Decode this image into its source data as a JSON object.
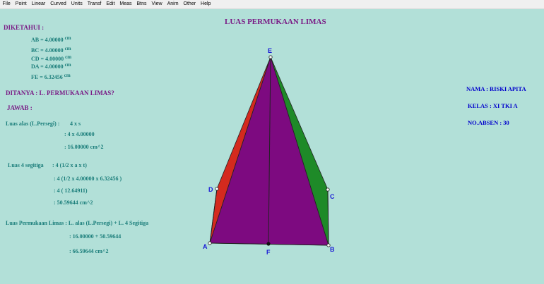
{
  "menu": [
    "File",
    "Point",
    "Linear",
    "Curved",
    "Units",
    "Transf",
    "Edit",
    "Meas",
    "Btns",
    "View",
    "Anim",
    "Other",
    "Help"
  ],
  "title": "LUAS PERMUKAAN LIMAS",
  "diketahui": {
    "heading": "DIKETAHUI :",
    "measures": [
      {
        "text": "AB = 4.00000",
        "unit": "cm"
      },
      {
        "text": "BC = 4.00000",
        "unit": "cm"
      },
      {
        "text": "CD = 4.00000",
        "unit": "cm"
      },
      {
        "text": "DA = 4.00000",
        "unit": "cm"
      },
      {
        "text": "FE = 6.32456",
        "unit": "cm"
      }
    ]
  },
  "ditanya": "DITANYA : L. PERMUKAAN LIMAS?",
  "jawab": "JAWAB :",
  "luas_alas": {
    "label": "Luas alas (L.Persegi) :",
    "expr": "4 x s",
    "step1": ": 4 x  4.00000",
    "result": ": 16.00000  cm^2"
  },
  "luas_segitiga": {
    "label": "Luas 4 segitiga",
    "expr": ": 4 (1/2 x a x t)",
    "step1": ": 4 (1/2 x  4.00000  x  6.32456 )",
    "step2": ": 4 (  12.64911)",
    "result": ": 50.59644  cm^2"
  },
  "luas_permukaan": {
    "label": "Luas Permukaan Limas : L. alas (L.Persegi) + L. 4 Segitiga",
    "step1": ":  16.00000   +   50.59644",
    "result": ":  66.59644  cm^2"
  },
  "student": {
    "nama": "NAMA : RISKI APITA",
    "kelas": "KELAS : XI TKI A",
    "absen": "NO.ABSEN : 30"
  },
  "vertices": {
    "A": "A",
    "B": "B",
    "C": "C",
    "D": "D",
    "E": "E",
    "F": "F"
  },
  "colors": {
    "background": "#b2e0d8",
    "face_front": "#7d0a80",
    "face_left": "#d42a1e",
    "face_right": "#1e8a28",
    "text_purple": "#7a1b86",
    "text_teal": "#1a7d7a",
    "text_blue": "#0000cc"
  }
}
